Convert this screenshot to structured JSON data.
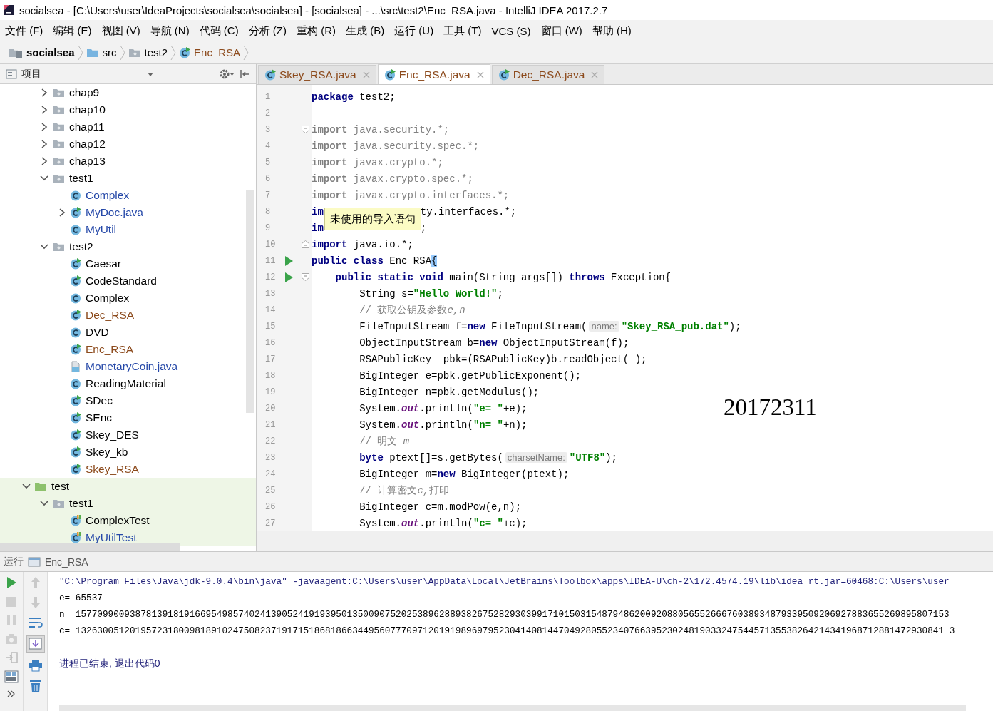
{
  "window": {
    "title": "socialsea - [C:\\Users\\user\\IdeaProjects\\socialsea\\socialsea] - [socialsea] - ...\\src\\test2\\Enc_RSA.java - IntelliJ IDEA 2017.2.7"
  },
  "menu": [
    "文件 (F)",
    "编辑 (E)",
    "视图 (V)",
    "导航 (N)",
    "代码 (C)",
    "分析 (Z)",
    "重构 (R)",
    "生成 (B)",
    "运行 (U)",
    "工具 (T)",
    "VCS (S)",
    "窗口 (W)",
    "帮助 (H)"
  ],
  "breadcrumb": [
    {
      "label": "socialsea",
      "kind": "module",
      "color": "#000000"
    },
    {
      "label": "src",
      "kind": "source_folder",
      "color": "#000000"
    },
    {
      "label": "test2",
      "kind": "package",
      "color": "#000000"
    },
    {
      "label": "Enc_RSA",
      "kind": "class",
      "color": "#8c4a1c"
    }
  ],
  "project": {
    "title": "项目",
    "tree": [
      {
        "children": [
          {
            "label": "chap9",
            "kind": "package",
            "expanded": false,
            "color": "#000000"
          },
          {
            "label": "chap10",
            "kind": "package",
            "expanded": false,
            "color": "#000000"
          },
          {
            "label": "chap11",
            "kind": "package",
            "expanded": false,
            "color": "#000000"
          },
          {
            "label": "chap12",
            "kind": "package",
            "expanded": false,
            "color": "#000000"
          },
          {
            "label": "chap13",
            "kind": "package",
            "expanded": false,
            "color": "#000000"
          },
          {
            "label": "test1",
            "kind": "package",
            "expanded": true,
            "color": "#000000",
            "children": [
              {
                "label": "Complex",
                "kind": "class",
                "color": "#2548a8"
              },
              {
                "label": "MyDoc.java",
                "kind": "class_run",
                "expanded": false,
                "color": "#2548a8"
              },
              {
                "label": "MyUtil",
                "kind": "class",
                "color": "#2548a8"
              }
            ]
          },
          {
            "label": "test2",
            "kind": "package",
            "expanded": true,
            "color": "#000000",
            "children": [
              {
                "label": "Caesar",
                "kind": "class_run",
                "color": "#000000"
              },
              {
                "label": "CodeStandard",
                "kind": "class_run",
                "color": "#000000"
              },
              {
                "label": "Complex",
                "kind": "class",
                "color": "#000000"
              },
              {
                "label": "Dec_RSA",
                "kind": "class_run",
                "color": "#8c4a1c"
              },
              {
                "label": "DVD",
                "kind": "class",
                "color": "#000000"
              },
              {
                "label": "Enc_RSA",
                "kind": "class_run",
                "color": "#8c4a1c"
              },
              {
                "label": "MonetaryCoin.java",
                "kind": "java_file",
                "color": "#2548a8"
              },
              {
                "label": "ReadingMaterial",
                "kind": "class",
                "color": "#000000"
              },
              {
                "label": "SDec",
                "kind": "class_run",
                "color": "#000000"
              },
              {
                "label": "SEnc",
                "kind": "class_run",
                "color": "#000000"
              },
              {
                "label": "Skey_DES",
                "kind": "class_run",
                "color": "#000000"
              },
              {
                "label": "Skey_kb",
                "kind": "class_run",
                "color": "#000000"
              },
              {
                "label": "Skey_RSA",
                "kind": "class_run",
                "color": "#8c4a1c"
              }
            ]
          }
        ]
      },
      {
        "label": "test",
        "kind": "test_root",
        "expanded": true,
        "color": "#000000",
        "children": [
          {
            "label": "test1",
            "kind": "package",
            "expanded": true,
            "color": "#000000",
            "children": [
              {
                "label": "ComplexTest",
                "kind": "test_class",
                "color": "#000000"
              },
              {
                "label": "MyUtilTest",
                "kind": "test_class",
                "color": "#2548a8"
              }
            ]
          }
        ]
      }
    ]
  },
  "editor": {
    "tabs": [
      {
        "label": "Skey_RSA.java",
        "selected": false,
        "color": "#8c4a1c"
      },
      {
        "label": "Enc_RSA.java",
        "selected": true,
        "color": "#8c4a1c"
      },
      {
        "label": "Dec_RSA.java",
        "selected": false,
        "color": "#8c4a1c"
      }
    ],
    "lines": [
      {
        "n": "1",
        "run": false,
        "tokens": [
          {
            "kind": "kw",
            "text": "package"
          },
          {
            "kind": "plain",
            "text": " test2;"
          }
        ]
      },
      {
        "n": "2",
        "run": false
      },
      {
        "n": "3",
        "run": false,
        "kind": "fold_start",
        "tokens": [
          {
            "kind": "dimkw",
            "text": "import"
          },
          {
            "kind": "dim",
            "text": " java.security.*;"
          }
        ]
      },
      {
        "n": "4",
        "run": false,
        "tokens": [
          {
            "kind": "dimkw",
            "text": "import"
          },
          {
            "kind": "dim",
            "text": " java.security.spec.*;"
          }
        ]
      },
      {
        "n": "5",
        "run": false,
        "tokens": [
          {
            "kind": "dimkw",
            "text": "import"
          },
          {
            "kind": "dim",
            "text": " javax.crypto.*;"
          }
        ]
      },
      {
        "n": "6",
        "run": false,
        "tokens": [
          {
            "kind": "dimkw",
            "text": "import"
          },
          {
            "kind": "dim",
            "text": " javax.crypto.spec.*;"
          }
        ]
      },
      {
        "n": "7",
        "run": false,
        "tokens": [
          {
            "kind": "dimkw",
            "text": "import"
          },
          {
            "kind": "dim",
            "text": " javax.crypto.interfaces.*;"
          }
        ]
      },
      {
        "n": "8",
        "run": false,
        "tokens": [
          {
            "kind": "kw",
            "text": "im"
          },
          {
            "kind": "after",
            "text": "ty.interfaces.*;"
          }
        ]
      },
      {
        "n": "9",
        "run": false,
        "tokens": [
          {
            "kind": "kw",
            "text": "im"
          },
          {
            "kind": "after",
            "text": ";"
          }
        ]
      },
      {
        "n": "10",
        "run": false,
        "kind": "fold_end",
        "tokens": [
          {
            "kind": "kw",
            "text": "import"
          },
          {
            "kind": "plain",
            "text": " java.io.*;"
          }
        ]
      },
      {
        "n": "11",
        "run": true,
        "tokens": [
          {
            "kind": "kw",
            "text": "public class"
          },
          {
            "kind": "plain",
            "text": " Enc_RSA"
          },
          {
            "kind": "match",
            "text": "{"
          }
        ]
      },
      {
        "n": "12",
        "run": true,
        "kind": "fold_start",
        "tokens": [
          {
            "kind": "kw",
            "text": "    public static void"
          },
          {
            "kind": "plain",
            "text": " main(String args[]) "
          },
          {
            "kind": "kw",
            "text": "throws"
          },
          {
            "kind": "plain",
            "text": " Exception{"
          }
        ]
      },
      {
        "n": "13",
        "run": false,
        "tokens": [
          {
            "kind": "plain",
            "text": "        String s="
          },
          {
            "kind": "str",
            "text": "\"Hello World!\""
          },
          {
            "kind": "plain",
            "text": ";"
          }
        ]
      },
      {
        "n": "14",
        "run": false,
        "tokens": [
          {
            "kind": "comment",
            "text": "        // 获取公钥及参数"
          },
          {
            "kind": "citalic",
            "text": "e,n"
          }
        ]
      },
      {
        "n": "15",
        "run": false,
        "tokens": [
          {
            "kind": "plain",
            "text": "        FileInputStream f="
          },
          {
            "kind": "kw",
            "text": "new"
          },
          {
            "kind": "plain",
            "text": " FileInputStream("
          },
          {
            "kind": "hint",
            "text": "name:"
          },
          {
            "kind": "str",
            "text": "\"Skey_RSA_pub.dat\""
          },
          {
            "kind": "plain",
            "text": ");"
          }
        ]
      },
      {
        "n": "16",
        "run": false,
        "tokens": [
          {
            "kind": "plain",
            "text": "        ObjectInputStream b="
          },
          {
            "kind": "kw",
            "text": "new"
          },
          {
            "kind": "plain",
            "text": " ObjectInputStream(f);"
          }
        ]
      },
      {
        "n": "17",
        "run": false,
        "tokens": [
          {
            "kind": "plain",
            "text": "        RSAPublicKey  pbk=(RSAPublicKey)b.readObject( );"
          }
        ]
      },
      {
        "n": "18",
        "run": false,
        "tokens": [
          {
            "kind": "plain",
            "text": "        BigInteger e=pbk.getPublicExponent();"
          }
        ]
      },
      {
        "n": "19",
        "run": false,
        "tokens": [
          {
            "kind": "plain",
            "text": "        BigInteger n=pbk.getModulus();"
          }
        ]
      },
      {
        "n": "20",
        "run": false,
        "tokens": [
          {
            "kind": "plain",
            "text": "        System."
          },
          {
            "kind": "field",
            "text": "out"
          },
          {
            "kind": "plain",
            "text": ".println("
          },
          {
            "kind": "str",
            "text": "\"e= \""
          },
          {
            "kind": "plain",
            "text": "+e);"
          }
        ]
      },
      {
        "n": "21",
        "run": false,
        "tokens": [
          {
            "kind": "plain",
            "text": "        System."
          },
          {
            "kind": "field",
            "text": "out"
          },
          {
            "kind": "plain",
            "text": ".println("
          },
          {
            "kind": "str",
            "text": "\"n= \""
          },
          {
            "kind": "plain",
            "text": "+n);"
          }
        ]
      },
      {
        "n": "22",
        "run": false,
        "tokens": [
          {
            "kind": "comment",
            "text": "        // 明文 "
          },
          {
            "kind": "citalic",
            "text": "m"
          }
        ]
      },
      {
        "n": "23",
        "run": false,
        "tokens": [
          {
            "kind": "kw",
            "text": "        byte"
          },
          {
            "kind": "plain",
            "text": " ptext[]=s.getBytes("
          },
          {
            "kind": "hint",
            "text": "charsetName:"
          },
          {
            "kind": "str",
            "text": "\"UTF8\""
          },
          {
            "kind": "plain",
            "text": ");"
          }
        ]
      },
      {
        "n": "24",
        "run": false,
        "tokens": [
          {
            "kind": "plain",
            "text": "        BigInteger m="
          },
          {
            "kind": "kw",
            "text": "new"
          },
          {
            "kind": "plain",
            "text": " BigInteger(ptext);"
          }
        ]
      },
      {
        "n": "25",
        "run": false,
        "tokens": [
          {
            "kind": "comment",
            "text": "        // 计算密文"
          },
          {
            "kind": "citalic",
            "text": "c,"
          },
          {
            "kind": "comment",
            "text": "打印"
          }
        ]
      },
      {
        "n": "26",
        "run": false,
        "tokens": [
          {
            "kind": "plain",
            "text": "        BigInteger c=m.modPow(e,n);"
          }
        ]
      },
      {
        "n": "27",
        "run": false,
        "tokens": [
          {
            "kind": "plain",
            "text": "        System."
          },
          {
            "kind": "field",
            "text": "out"
          },
          {
            "kind": "plain",
            "text": ".println("
          },
          {
            "kind": "str",
            "text": "\"c= \""
          },
          {
            "kind": "plain",
            "text": "+c);"
          }
        ]
      }
    ],
    "tooltip": "未使用的导入语句",
    "annotation": "20172311"
  },
  "run": {
    "title": "运行",
    "config": "Enc_RSA",
    "scroll_to_end": true,
    "lines": [
      {
        "kind": "command",
        "text": "\"C:\\Program Files\\Java\\jdk-9.0.4\\bin\\java\" -javaagent:C:\\Users\\user\\AppData\\Local\\JetBrains\\Toolbox\\apps\\IDEA-U\\ch-2\\172.4574.19\\lib\\idea_rt.jar=60468:C:\\Users\\user"
      },
      {
        "kind": "output",
        "text": "e= 65537"
      },
      {
        "kind": "output",
        "text": "n= 15770990093878139181916695498574024139052419193950135009075202538962889382675282930399171015031548794862009208805655266676038934879339509206927883655269895807153"
      },
      {
        "kind": "output",
        "text": "c= 1326300512019572318009818910247508237191715186818663449560777097120191989697952304140814470492805523407663952302481903324754457135538264214341968712881472930841 3"
      },
      {
        "kind": "exit",
        "text": "进程已结束, 退出代码0"
      }
    ]
  }
}
